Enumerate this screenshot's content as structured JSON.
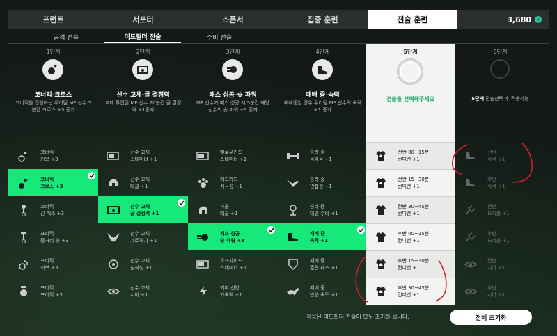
{
  "top_tabs": [
    "프런트",
    "서포터",
    "스폰서",
    "집중 훈련",
    "전술 훈련"
  ],
  "currency": {
    "amount": "3,680",
    "icon": "coin-icon"
  },
  "sub_tabs": [
    "공격 전술",
    "미드필더 전술",
    "수비 전술"
  ],
  "columns": [
    {
      "stage": "1단계",
      "title": "코너킥-크로스",
      "desc": "코너킥을 진행하는 우리팀 MF 선수 5분간 크로스 +3 증가"
    },
    {
      "stage": "2단계",
      "title": "선수 교체-골 결정력",
      "desc": "교체 투입된 MF 선수 20분간 골 결정력 +1증가"
    },
    {
      "stage": "3단계",
      "title": "패스 성공-슛 파워",
      "desc": "MF 선수가 패스 성공 시 5분간 해당 선수의 슛 파워 +3 증가"
    },
    {
      "stage": "4단계",
      "title": "패배 중-속력",
      "desc": "패배중일 경우 우리팀 MF 선수의 속력 +1 증가"
    },
    {
      "stage": "5단계",
      "title": "",
      "desc": "전술을 선택해주세요"
    },
    {
      "stage": "6단계",
      "title": "",
      "desc_bold": "5단계",
      "desc": " 전술선택 후 적용가능"
    }
  ],
  "grid": [
    [
      [
        "코너킥",
        "커브 +3"
      ],
      [
        "선수 교체",
        "스태미너 +1"
      ],
      [
        "옐로우카드",
        "스태미너 +1"
      ],
      [
        "승리 중",
        "몸싸움 +1"
      ],
      [
        "전반 00~15분",
        "컨디션 +1"
      ],
      [
        "전반",
        "속력 +1"
      ]
    ],
    [
      [
        "코너킥",
        "크로스 +3"
      ],
      [
        "선수 교체",
        "태클 +1"
      ],
      [
        "레드카드",
        "적극성 +1"
      ],
      [
        "승리 중",
        "민첩성 +1"
      ],
      [
        "전반 15~30분",
        "컨디션 +1"
      ],
      [
        "후반",
        "속력 +1"
      ]
    ],
    [
      [
        "코너킥",
        "긴 패스 +3"
      ],
      [
        "선수 교체",
        "골 결정력 +1"
      ],
      [
        "파울",
        "태클 +1"
      ],
      [
        "승리 중",
        "대인 수비 +1"
      ],
      [
        "전반 30~45분",
        "컨디션 +1"
      ],
      [
        "전반",
        "드리블 +1"
      ]
    ],
    [
      [
        "프리킥",
        "중거리 슛 +3"
      ],
      [
        "선수 교체",
        "가로채기 +1"
      ],
      [
        "패스 성공",
        "슛 파워 +3"
      ],
      [
        "패배 중",
        "속력 +1"
      ],
      [
        "후반 00~15분",
        "컨디션 +1"
      ],
      [
        "후반",
        "드리블 +1"
      ]
    ],
    [
      [
        "프리킥",
        "커브 +3"
      ],
      [
        "선수 교체",
        "침착성 +1"
      ],
      [
        "오프사이드",
        "스태미너 +1"
      ],
      [
        "패배 중",
        "짧은 패스 +1"
      ],
      [
        "후반 15~30분",
        "컨디션 +1"
      ],
      [
        "전반",
        "시야 +1"
      ]
    ],
    [
      [
        "프리킥",
        "프리킥 +3"
      ],
      [
        "선수 교체",
        "시야 +1"
      ],
      [
        "키퍼 선방",
        "가속력 +1"
      ],
      [
        "패배 중",
        "반응 속도 +1"
      ],
      [
        "후반 30~45분",
        "컨디션 +1"
      ],
      [
        "후반",
        "시야 +1"
      ]
    ]
  ],
  "selected": {
    "col0": 1,
    "col1": 2,
    "col2": 3,
    "col3": 3
  },
  "footer": {
    "note": "적용된 미드필더 전술이 모두 초기화 됩니다.",
    "reset_label": "전체 초기화"
  },
  "colors": {
    "accent": "#17e87a",
    "annotation": "#d0202a"
  }
}
